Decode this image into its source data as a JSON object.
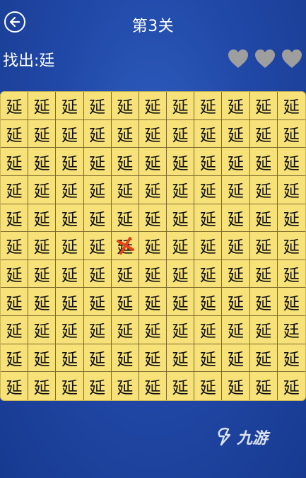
{
  "header": {
    "title": "第3关"
  },
  "target": {
    "prefix": "找出:",
    "char": "廷"
  },
  "hearts": {
    "count": 3,
    "color": "#9e9e9e"
  },
  "board": {
    "rows": 11,
    "cols": 11,
    "default_char": "延",
    "odd_char": "廷",
    "odd_cell": [
      8,
      10
    ],
    "wrong_tap": [
      5,
      4
    ],
    "wrong_mark_color": "#e8421b"
  },
  "watermark": {
    "text": "九游"
  }
}
